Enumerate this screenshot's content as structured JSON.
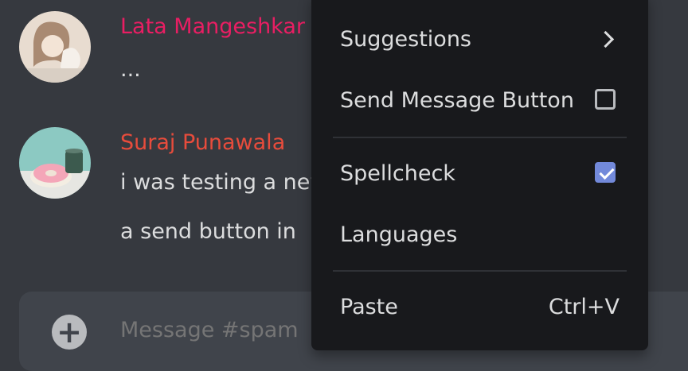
{
  "messages": [
    {
      "author": "Lata Mangeshkar",
      "author_color": "#e91e63",
      "lines": [
        "..."
      ]
    },
    {
      "author": "Suraj Punawala",
      "author_color": "#e74c3c",
      "lines": [
        "i was testing a new",
        "a send button in"
      ]
    }
  ],
  "composer": {
    "placeholder": "Message #spam",
    "add_icon": "plus-circle-icon"
  },
  "context_menu": {
    "items": [
      {
        "label": "Suggestions",
        "icon": "chevron-right-icon"
      },
      {
        "label": "Send Message Button",
        "checked": false
      },
      {
        "label": "Spellcheck",
        "checked": true
      },
      {
        "label": "Languages"
      },
      {
        "label": "Paste",
        "shortcut": "Ctrl+V"
      }
    ]
  },
  "colors": {
    "background": "#36393f",
    "menu": "#18191c",
    "accent": "#7289da"
  }
}
